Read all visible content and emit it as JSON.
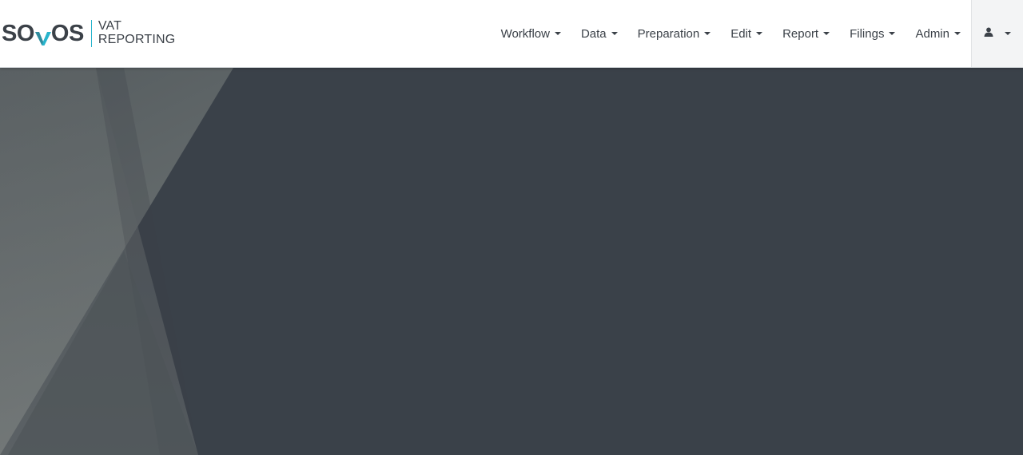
{
  "brand": {
    "logo_text_left": "SO",
    "logo_text_right": "OS",
    "product_line1": "VAT",
    "product_line2": "REPORTING",
    "accent_color": "#28b4cc"
  },
  "nav": {
    "items": [
      {
        "label": "Workflow"
      },
      {
        "label": "Data"
      },
      {
        "label": "Preparation"
      },
      {
        "label": "Edit"
      },
      {
        "label": "Report"
      },
      {
        "label": "Filings"
      },
      {
        "label": "Admin"
      }
    ],
    "user_icon": "user-icon"
  },
  "hero": {
    "background_color": "#3a4149"
  }
}
